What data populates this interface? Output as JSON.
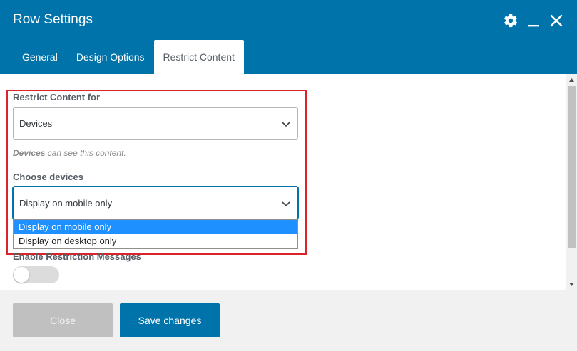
{
  "header": {
    "title": "Row Settings",
    "colors": {
      "background": "#0073aa",
      "text": "#ffffff"
    },
    "icons": [
      "gear-icon",
      "minimize-icon",
      "close-icon"
    ]
  },
  "tabs": [
    {
      "label": "General",
      "active": false
    },
    {
      "label": "Design Options",
      "active": false
    },
    {
      "label": "Restrict Content",
      "active": true
    }
  ],
  "restrict": {
    "label": "Restrict Content for",
    "selected": "Devices",
    "hint_emphasis": "Devices",
    "hint_rest": " can see this content."
  },
  "devices": {
    "label": "Choose devices",
    "selected": "Display on mobile only",
    "options": [
      {
        "label": "Display on mobile only",
        "highlighted": true
      },
      {
        "label": "Display on desktop only",
        "highlighted": false
      }
    ]
  },
  "restriction_messages": {
    "label": "Enable Restriction Messages",
    "enabled": false
  },
  "footer": {
    "close_label": "Close",
    "save_label": "Save changes"
  },
  "colors": {
    "accent": "#0073aa",
    "highlight_border": "#d9242b",
    "option_selected": "#1e90ff"
  }
}
